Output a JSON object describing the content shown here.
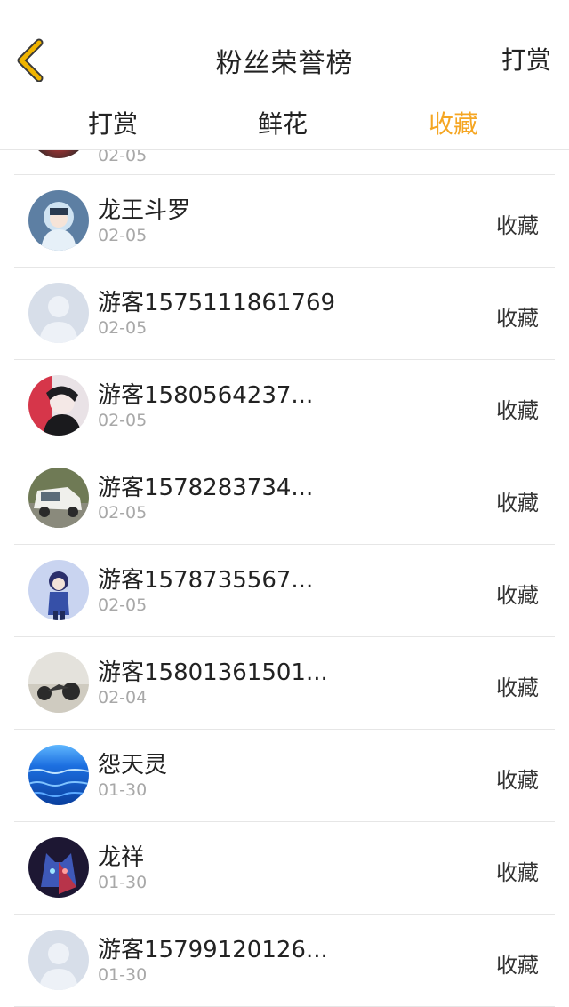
{
  "header": {
    "title": "粉丝荣誉榜",
    "right_label": "打赏",
    "back_icon": "chevron-left-icon",
    "accent_color": "#f5a623"
  },
  "tabs": [
    {
      "label": "打赏",
      "active": false
    },
    {
      "label": "鲜花",
      "active": false
    },
    {
      "label": "收藏",
      "active": true
    }
  ],
  "list": {
    "partial_top_date": "02-05",
    "rows": [
      {
        "name": "龙王斗罗",
        "date": "02-05",
        "action": "收藏",
        "avatar": "anime-hoodie-avatar"
      },
      {
        "name": "游客1575111861769",
        "date": "02-05",
        "action": "收藏",
        "avatar": "default-user-avatar"
      },
      {
        "name": "游客1580564237...",
        "date": "02-05",
        "action": "收藏",
        "avatar": "anime-boy-avatar"
      },
      {
        "name": "游客1578283734...",
        "date": "02-05",
        "action": "收藏",
        "avatar": "white-van-avatar"
      },
      {
        "name": "游客1578735567...",
        "date": "02-05",
        "action": "收藏",
        "avatar": "anime-swordsman-avatar"
      },
      {
        "name": "游客15801361501...",
        "date": "02-04",
        "action": "收藏",
        "avatar": "motorcycle-avatar"
      },
      {
        "name": "怨天灵",
        "date": "01-30",
        "action": "收藏",
        "avatar": "ocean-avatar"
      },
      {
        "name": "龙祥",
        "date": "01-30",
        "action": "收藏",
        "avatar": "wolf-avatar"
      },
      {
        "name": "游客15799120126...",
        "date": "01-30",
        "action": "收藏",
        "avatar": "default-user-avatar"
      }
    ]
  }
}
